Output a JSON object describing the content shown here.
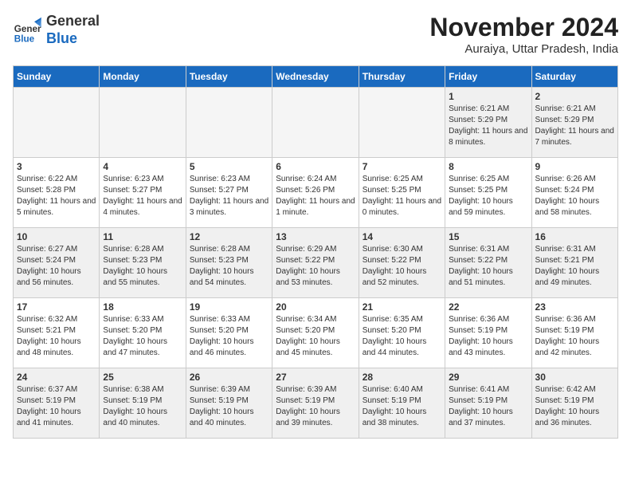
{
  "logo": {
    "line1": "General",
    "line2": "Blue"
  },
  "title": "November 2024",
  "subtitle": "Auraiya, Uttar Pradesh, India",
  "days_of_week": [
    "Sunday",
    "Monday",
    "Tuesday",
    "Wednesday",
    "Thursday",
    "Friday",
    "Saturday"
  ],
  "weeks": [
    [
      {
        "day": "",
        "empty": true
      },
      {
        "day": "",
        "empty": true
      },
      {
        "day": "",
        "empty": true
      },
      {
        "day": "",
        "empty": true
      },
      {
        "day": "",
        "empty": true
      },
      {
        "day": "1",
        "sunrise": "6:21 AM",
        "sunset": "5:29 PM",
        "daylight": "11 hours and 8 minutes."
      },
      {
        "day": "2",
        "sunrise": "6:21 AM",
        "sunset": "5:29 PM",
        "daylight": "11 hours and 7 minutes."
      }
    ],
    [
      {
        "day": "3",
        "sunrise": "6:22 AM",
        "sunset": "5:28 PM",
        "daylight": "11 hours and 5 minutes."
      },
      {
        "day": "4",
        "sunrise": "6:23 AM",
        "sunset": "5:27 PM",
        "daylight": "11 hours and 4 minutes."
      },
      {
        "day": "5",
        "sunrise": "6:23 AM",
        "sunset": "5:27 PM",
        "daylight": "11 hours and 3 minutes."
      },
      {
        "day": "6",
        "sunrise": "6:24 AM",
        "sunset": "5:26 PM",
        "daylight": "11 hours and 1 minute."
      },
      {
        "day": "7",
        "sunrise": "6:25 AM",
        "sunset": "5:25 PM",
        "daylight": "11 hours and 0 minutes."
      },
      {
        "day": "8",
        "sunrise": "6:25 AM",
        "sunset": "5:25 PM",
        "daylight": "10 hours and 59 minutes."
      },
      {
        "day": "9",
        "sunrise": "6:26 AM",
        "sunset": "5:24 PM",
        "daylight": "10 hours and 58 minutes."
      }
    ],
    [
      {
        "day": "10",
        "sunrise": "6:27 AM",
        "sunset": "5:24 PM",
        "daylight": "10 hours and 56 minutes."
      },
      {
        "day": "11",
        "sunrise": "6:28 AM",
        "sunset": "5:23 PM",
        "daylight": "10 hours and 55 minutes."
      },
      {
        "day": "12",
        "sunrise": "6:28 AM",
        "sunset": "5:23 PM",
        "daylight": "10 hours and 54 minutes."
      },
      {
        "day": "13",
        "sunrise": "6:29 AM",
        "sunset": "5:22 PM",
        "daylight": "10 hours and 53 minutes."
      },
      {
        "day": "14",
        "sunrise": "6:30 AM",
        "sunset": "5:22 PM",
        "daylight": "10 hours and 52 minutes."
      },
      {
        "day": "15",
        "sunrise": "6:31 AM",
        "sunset": "5:22 PM",
        "daylight": "10 hours and 51 minutes."
      },
      {
        "day": "16",
        "sunrise": "6:31 AM",
        "sunset": "5:21 PM",
        "daylight": "10 hours and 49 minutes."
      }
    ],
    [
      {
        "day": "17",
        "sunrise": "6:32 AM",
        "sunset": "5:21 PM",
        "daylight": "10 hours and 48 minutes."
      },
      {
        "day": "18",
        "sunrise": "6:33 AM",
        "sunset": "5:20 PM",
        "daylight": "10 hours and 47 minutes."
      },
      {
        "day": "19",
        "sunrise": "6:33 AM",
        "sunset": "5:20 PM",
        "daylight": "10 hours and 46 minutes."
      },
      {
        "day": "20",
        "sunrise": "6:34 AM",
        "sunset": "5:20 PM",
        "daylight": "10 hours and 45 minutes."
      },
      {
        "day": "21",
        "sunrise": "6:35 AM",
        "sunset": "5:20 PM",
        "daylight": "10 hours and 44 minutes."
      },
      {
        "day": "22",
        "sunrise": "6:36 AM",
        "sunset": "5:19 PM",
        "daylight": "10 hours and 43 minutes."
      },
      {
        "day": "23",
        "sunrise": "6:36 AM",
        "sunset": "5:19 PM",
        "daylight": "10 hours and 42 minutes."
      }
    ],
    [
      {
        "day": "24",
        "sunrise": "6:37 AM",
        "sunset": "5:19 PM",
        "daylight": "10 hours and 41 minutes."
      },
      {
        "day": "25",
        "sunrise": "6:38 AM",
        "sunset": "5:19 PM",
        "daylight": "10 hours and 40 minutes."
      },
      {
        "day": "26",
        "sunrise": "6:39 AM",
        "sunset": "5:19 PM",
        "daylight": "10 hours and 40 minutes."
      },
      {
        "day": "27",
        "sunrise": "6:39 AM",
        "sunset": "5:19 PM",
        "daylight": "10 hours and 39 minutes."
      },
      {
        "day": "28",
        "sunrise": "6:40 AM",
        "sunset": "5:19 PM",
        "daylight": "10 hours and 38 minutes."
      },
      {
        "day": "29",
        "sunrise": "6:41 AM",
        "sunset": "5:19 PM",
        "daylight": "10 hours and 37 minutes."
      },
      {
        "day": "30",
        "sunrise": "6:42 AM",
        "sunset": "5:19 PM",
        "daylight": "10 hours and 36 minutes."
      }
    ]
  ]
}
